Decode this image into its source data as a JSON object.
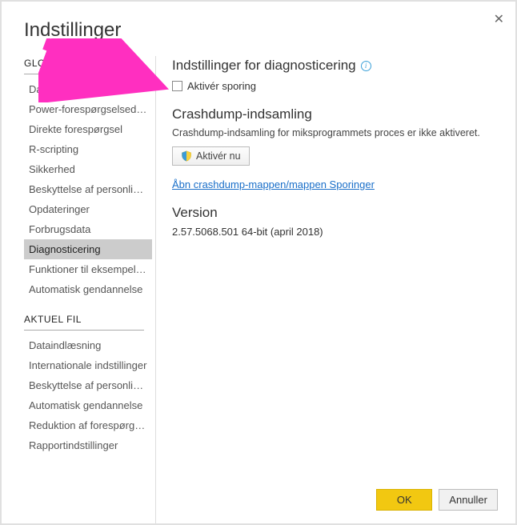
{
  "window": {
    "title": "Indstillinger"
  },
  "sidebar": {
    "sections": [
      {
        "head": "GLOBALE",
        "items": [
          {
            "label": "Dataindlæsning",
            "selected": false
          },
          {
            "label": "Power-forespørgselseditor",
            "selected": false
          },
          {
            "label": "Direkte forespørgsel",
            "selected": false
          },
          {
            "label": "R-scripting",
            "selected": false
          },
          {
            "label": "Sikkerhed",
            "selected": false
          },
          {
            "label": "Beskyttelse af personlige...",
            "selected": false
          },
          {
            "label": "Opdateringer",
            "selected": false
          },
          {
            "label": "Forbrugsdata",
            "selected": false
          },
          {
            "label": "Diagnosticering",
            "selected": true
          },
          {
            "label": "Funktioner til eksempelv...",
            "selected": false
          },
          {
            "label": "Automatisk gendannelse",
            "selected": false
          }
        ]
      },
      {
        "head": "AKTUEL FIL",
        "items": [
          {
            "label": "Dataindlæsning",
            "selected": false
          },
          {
            "label": "Internationale indstillinger",
            "selected": false
          },
          {
            "label": "Beskyttelse af personlige...",
            "selected": false
          },
          {
            "label": "Automatisk gendannelse",
            "selected": false
          },
          {
            "label": "Reduktion af forespørgsl...",
            "selected": false
          },
          {
            "label": "Rapportindstillinger",
            "selected": false
          }
        ]
      }
    ]
  },
  "main": {
    "diag": {
      "title": "Indstillinger for diagnosticering",
      "checkbox_label": "Aktivér sporing",
      "checked": false
    },
    "crash": {
      "title": "Crashdump-indsamling",
      "desc": "Crashdump-indsamling for miksprogrammets proces er ikke aktiveret.",
      "button": "Aktivér nu",
      "link": "Åbn crashdump-mappen/mappen Sporinger"
    },
    "version": {
      "title": "Version",
      "value": "2.57.5068.501 64-bit (april 2018)"
    }
  },
  "footer": {
    "ok": "OK",
    "cancel": "Annuller"
  }
}
